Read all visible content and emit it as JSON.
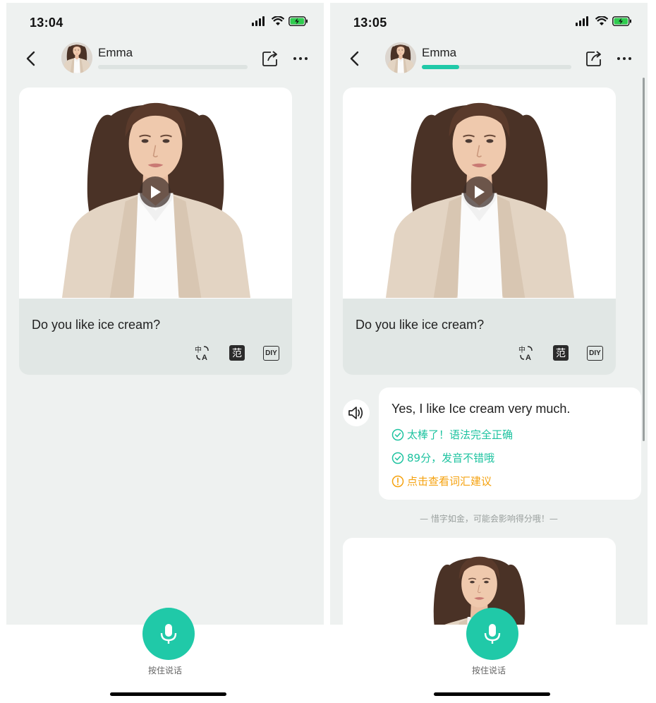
{
  "screens": [
    {
      "time": "13:04",
      "contact_name": "Emma",
      "progress": 0.0,
      "card": {
        "question": "Do you like ice cream?",
        "tool_fan": "范",
        "tool_diy": "DIY"
      },
      "mic_label": "按住说话"
    },
    {
      "time": "13:05",
      "contact_name": "Emma",
      "progress": 0.25,
      "card": {
        "question": "Do you like ice cream?",
        "tool_fan": "范",
        "tool_diy": "DIY"
      },
      "reply": {
        "text": "Yes, I like Ice cream very much.",
        "feedback_grammar": "太棒了！语法完全正确",
        "feedback_pronunciation": "89分，发音不错哦",
        "feedback_vocab": "点击查看词汇建议"
      },
      "hint": "— 惜字如金，可能会影响得分哦！—",
      "mic_label": "按住说话"
    }
  ],
  "colors": {
    "accent": "#20c9a8",
    "warning": "#f5a20f",
    "background": "#eef1f0"
  },
  "icons": [
    "back-icon",
    "share-icon",
    "more-icon",
    "play-icon",
    "translate-icon",
    "speaker-icon",
    "check-circle-icon",
    "info-circle-icon",
    "mic-icon",
    "signal-icon",
    "wifi-icon",
    "battery-icon"
  ]
}
